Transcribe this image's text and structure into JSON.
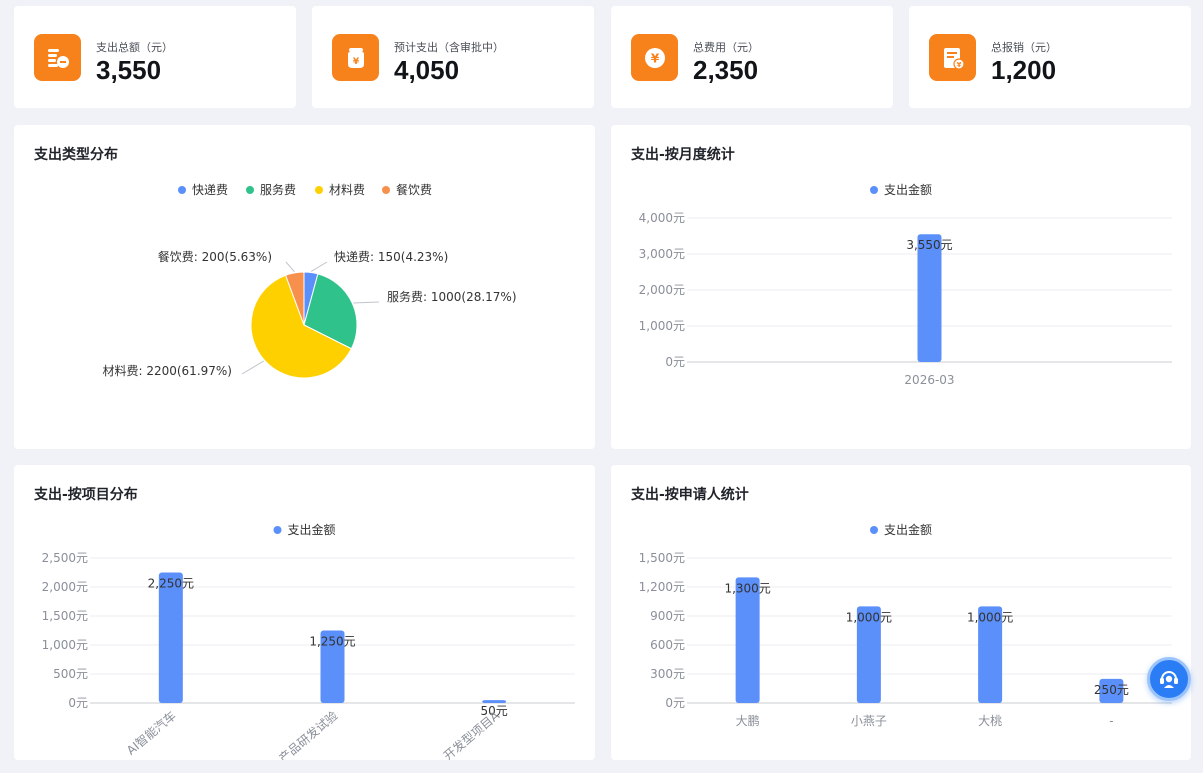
{
  "stats": [
    {
      "label": "支出总额（元）",
      "value": "3,550",
      "icon": "expense-total-icon"
    },
    {
      "label": "预计支出（含审批中）",
      "value": "4,050",
      "icon": "money-bag-icon"
    },
    {
      "label": "总费用（元）",
      "value": "2,350",
      "icon": "yen-coin-icon"
    },
    {
      "label": "总报销（元）",
      "value": "1,200",
      "icon": "reimbursement-icon"
    }
  ],
  "colors": {
    "accent": "#f7821b",
    "bar": "#5b8ff9",
    "pie": [
      "#5b8ff9",
      "#2fc28b",
      "#ffd000",
      "#f7904c"
    ]
  },
  "charts": {
    "type_pie": {
      "title": "支出类型分布",
      "chart_data": {
        "type": "pie",
        "legend": [
          "快递费",
          "服务费",
          "材料费",
          "餐饮费"
        ],
        "slices": [
          {
            "name": "快递费",
            "value": 150,
            "label": "快递费: 150(4.23%)"
          },
          {
            "name": "服务费",
            "value": 1000,
            "label": "服务费: 1000(28.17%)"
          },
          {
            "name": "材料费",
            "value": 2200,
            "label": "材料费: 2200(61.97%)"
          },
          {
            "name": "餐饮费",
            "value": 200,
            "label": "餐饮费: 200(5.63%)"
          }
        ]
      }
    },
    "monthly": {
      "title": "支出-按月度统计",
      "chart_data": {
        "type": "bar",
        "legend": "支出金额",
        "categories": [
          "2026-03"
        ],
        "values": [
          3550
        ],
        "value_labels": [
          "3,550元"
        ],
        "ylim": [
          0,
          4000
        ],
        "yticks": [
          "0元",
          "1,000元",
          "2,000元",
          "3,000元",
          "4,000元"
        ]
      }
    },
    "project": {
      "title": "支出-按项目分布",
      "chart_data": {
        "type": "bar",
        "legend": "支出金额",
        "categories": [
          "AI智能汽车",
          "产品研发试验",
          "开发型项目A"
        ],
        "values": [
          2250,
          1250,
          50
        ],
        "value_labels": [
          "2,250元",
          "1,250元",
          "50元"
        ],
        "ylim": [
          0,
          2500
        ],
        "yticks": [
          "0元",
          "500元",
          "1,000元",
          "1,500元",
          "2,000元",
          "2,500元"
        ]
      }
    },
    "applicant": {
      "title": "支出-按申请人统计",
      "chart_data": {
        "type": "bar",
        "legend": "支出金额",
        "categories": [
          "大鹏",
          "小燕子",
          "大桃",
          "-"
        ],
        "values": [
          1300,
          1000,
          1000,
          250
        ],
        "value_labels": [
          "1,300元",
          "1,000元",
          "1,000元",
          "250元"
        ],
        "ylim": [
          0,
          1500
        ],
        "yticks": [
          "0元",
          "300元",
          "600元",
          "900元",
          "1,200元",
          "1,500元"
        ]
      }
    }
  },
  "floating_button": {
    "icon": "customer-service-icon"
  }
}
